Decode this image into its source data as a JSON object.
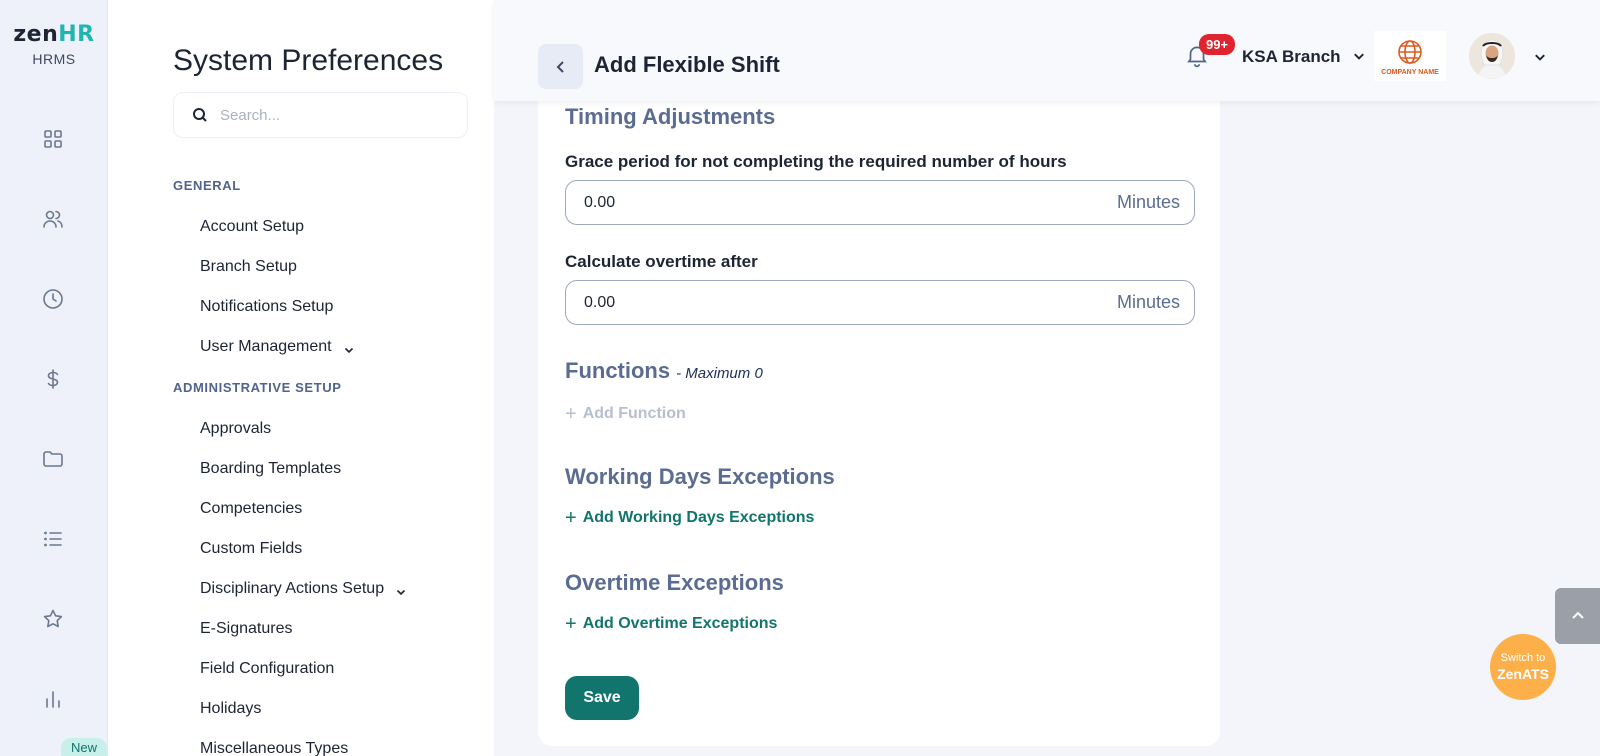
{
  "brand": {
    "logo_left": "zen",
    "logo_right": "HR",
    "product": "HRMS",
    "new_badge": "New"
  },
  "rail": {
    "icons": [
      "dashboard-icon",
      "people-icon",
      "clock-icon",
      "dollar-icon",
      "folder-icon",
      "list-icon",
      "star-icon",
      "bar-chart-icon"
    ]
  },
  "prefs": {
    "title": "System Preferences",
    "search_placeholder": "Search...",
    "sections": {
      "general": {
        "label": "GENERAL",
        "items": [
          "Account Setup",
          "Branch Setup",
          "Notifications Setup",
          "User Management"
        ]
      },
      "admin": {
        "label": "ADMINISTRATIVE SETUP",
        "items": [
          "Approvals",
          "Boarding Templates",
          "Competencies",
          "Custom Fields",
          "Disciplinary Actions Setup",
          "E-Signatures",
          "Field Configuration",
          "Holidays",
          "Miscellaneous Types"
        ]
      }
    }
  },
  "header": {
    "title": "Add Flexible Shift",
    "notifications": "99+",
    "branch": "KSA Branch",
    "company_logo_text": "COMPANY NAME"
  },
  "form": {
    "timing_heading": "Timing Adjustments",
    "grace": {
      "label": "Grace period for not completing the required number of hours",
      "value": "0.00",
      "unit": "Minutes"
    },
    "overtime": {
      "label": "Calculate overtime after",
      "value": "0.00",
      "unit": "Minutes"
    },
    "functions_heading": "Functions",
    "functions_sub": "- Maximum 0",
    "add_function": "Add Function",
    "working_days_heading": "Working Days Exceptions",
    "add_working_days": "Add Working Days Exceptions",
    "overtime_exc_heading": "Overtime Exceptions",
    "add_overtime_exc": "Add Overtime Exceptions",
    "save": "Save",
    "plus": "+"
  },
  "switch_ats": {
    "line1": "Switch to",
    "line2": "ZenATS"
  },
  "colors": {
    "accent": "#12756d",
    "heading": "#5b6c92",
    "badge": "#e0242f",
    "ats": "#fdb04a"
  }
}
